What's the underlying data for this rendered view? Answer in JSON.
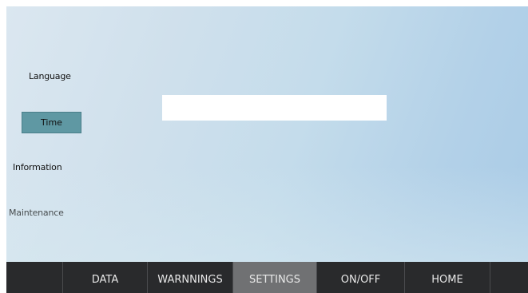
{
  "sidebar": {
    "items": [
      {
        "label": "Language",
        "selected": false
      },
      {
        "label": "Time",
        "selected": true
      },
      {
        "label": "Information",
        "selected": false
      },
      {
        "label": "Maintenance",
        "selected": false
      }
    ]
  },
  "time_field": {
    "value": ""
  },
  "navbar": {
    "tabs": [
      {
        "label": ""
      },
      {
        "label": "DATA"
      },
      {
        "label": "WARNNINGS"
      },
      {
        "label": "SETTINGS",
        "active": true
      },
      {
        "label": "ON/OFF"
      },
      {
        "label": "HOME"
      },
      {
        "label": ""
      }
    ]
  },
  "colors": {
    "selected_item": "#5f98a3",
    "active_tab": "#707173",
    "navbar_bg": "#292a2c"
  }
}
